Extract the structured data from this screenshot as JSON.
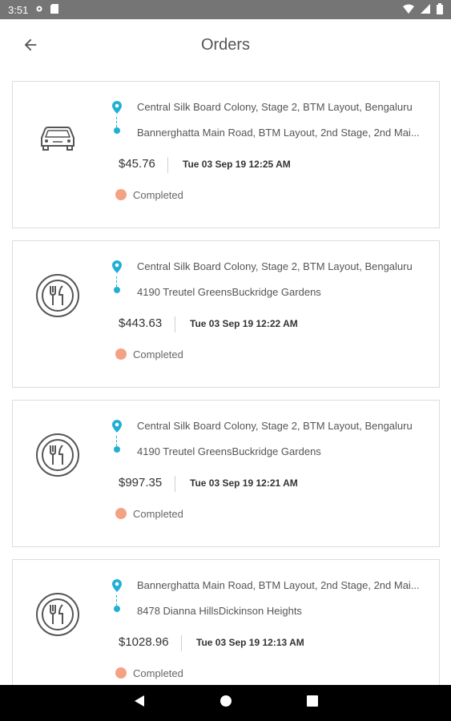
{
  "status_bar": {
    "time": "3:51"
  },
  "header": {
    "title": "Orders"
  },
  "orders": [
    {
      "icon": "car-icon",
      "from": "Central Silk Board Colony, Stage 2, BTM Layout, Bengaluru",
      "to": "Bannerghatta Main Road, BTM Layout, 2nd Stage, 2nd Mai...",
      "price": "$45.76",
      "datetime": "Tue 03 Sep 19 12:25 AM",
      "status": "Completed"
    },
    {
      "icon": "restaurant-icon",
      "from": "Central Silk Board Colony, Stage 2, BTM Layout, Bengaluru",
      "to": "4190 Treutel GreensBuckridge Gardens",
      "price": "$443.63",
      "datetime": "Tue 03 Sep 19 12:22 AM",
      "status": "Completed"
    },
    {
      "icon": "restaurant-icon",
      "from": "Central Silk Board Colony, Stage 2, BTM Layout, Bengaluru",
      "to": "4190 Treutel GreensBuckridge Gardens",
      "price": "$997.35",
      "datetime": "Tue 03 Sep 19 12:21 AM",
      "status": "Completed"
    },
    {
      "icon": "restaurant-icon",
      "from": "Bannerghatta Main Road, BTM Layout, 2nd Stage, 2nd Mai...",
      "to": "8478 Dianna HillsDickinson Heights",
      "price": "$1028.96",
      "datetime": "Tue 03 Sep 19 12:13 AM",
      "status": "Completed"
    }
  ],
  "colors": {
    "accent": "#1fb0d3",
    "completed": "#f4a184"
  }
}
